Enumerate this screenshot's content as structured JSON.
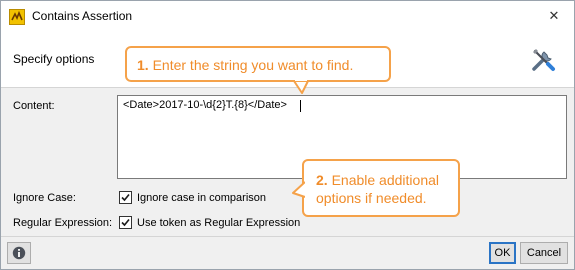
{
  "window": {
    "title": "Contains Assertion",
    "close_glyph": "✕"
  },
  "header": {
    "title": "Specify options",
    "icon": "tools-icon"
  },
  "form": {
    "content_label": "Content:",
    "content_value": "<Date>2017-10-\\d{2}T.{8}</Date>",
    "ignore_case_label": "Ignore Case:",
    "ignore_case_checkbox_label": "Ignore case in comparison",
    "ignore_case_checked": true,
    "regex_label": "Regular Expression:",
    "regex_checkbox_label": "Use token as Regular Expression",
    "regex_checked": true
  },
  "footer": {
    "ok_label": "OK",
    "cancel_label": "Cancel",
    "info_icon": "info-icon"
  },
  "callouts": [
    {
      "number": "1.",
      "text": "Enter the string you want to find."
    },
    {
      "number": "2.",
      "text": "Enable additional options if needed."
    }
  ],
  "colors": {
    "callout_accent": "#f5a24a",
    "callout_text": "#f08c2a",
    "ok_border": "#2a74c5"
  }
}
